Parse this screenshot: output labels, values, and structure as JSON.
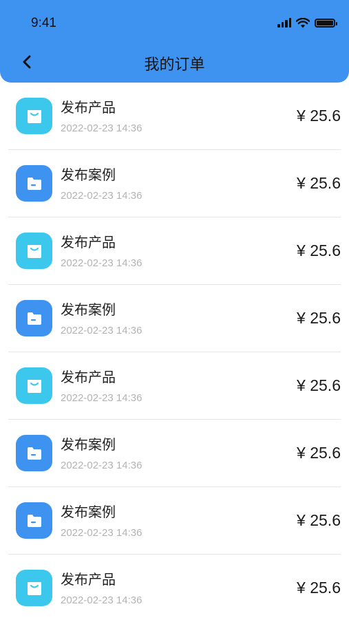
{
  "status_bar": {
    "time": "9:41"
  },
  "header": {
    "title": "我的订单"
  },
  "orders": [
    {
      "title": "发布产品",
      "date": "2022-02-23 14:36",
      "price": "¥ 25.6",
      "icon": "shopping-bag-icon",
      "icon_color": "#3cc8ec"
    },
    {
      "title": "发布案例",
      "date": "2022-02-23 14:36",
      "price": "¥ 25.6",
      "icon": "folder-icon",
      "icon_color": "#3f93f0"
    },
    {
      "title": "发布产品",
      "date": "2022-02-23 14:36",
      "price": "¥ 25.6",
      "icon": "shopping-bag-icon",
      "icon_color": "#3cc8ec"
    },
    {
      "title": "发布案例",
      "date": "2022-02-23 14:36",
      "price": "¥ 25.6",
      "icon": "folder-icon",
      "icon_color": "#3f93f0"
    },
    {
      "title": "发布产品",
      "date": "2022-02-23 14:36",
      "price": "¥ 25.6",
      "icon": "shopping-bag-icon",
      "icon_color": "#3cc8ec"
    },
    {
      "title": "发布案例",
      "date": "2022-02-23 14:36",
      "price": "¥ 25.6",
      "icon": "folder-icon",
      "icon_color": "#3f93f0"
    },
    {
      "title": "发布案例",
      "date": "2022-02-23 14:36",
      "price": "¥ 25.6",
      "icon": "folder-icon",
      "icon_color": "#3f93f0"
    },
    {
      "title": "发布产品",
      "date": "2022-02-23 14:36",
      "price": "¥ 25.6",
      "icon": "shopping-bag-icon",
      "icon_color": "#3cc8ec"
    }
  ],
  "colors": {
    "header_bg": "#3f93f0",
    "product_icon": "#3cc8ec",
    "case_icon": "#3f93f0"
  }
}
